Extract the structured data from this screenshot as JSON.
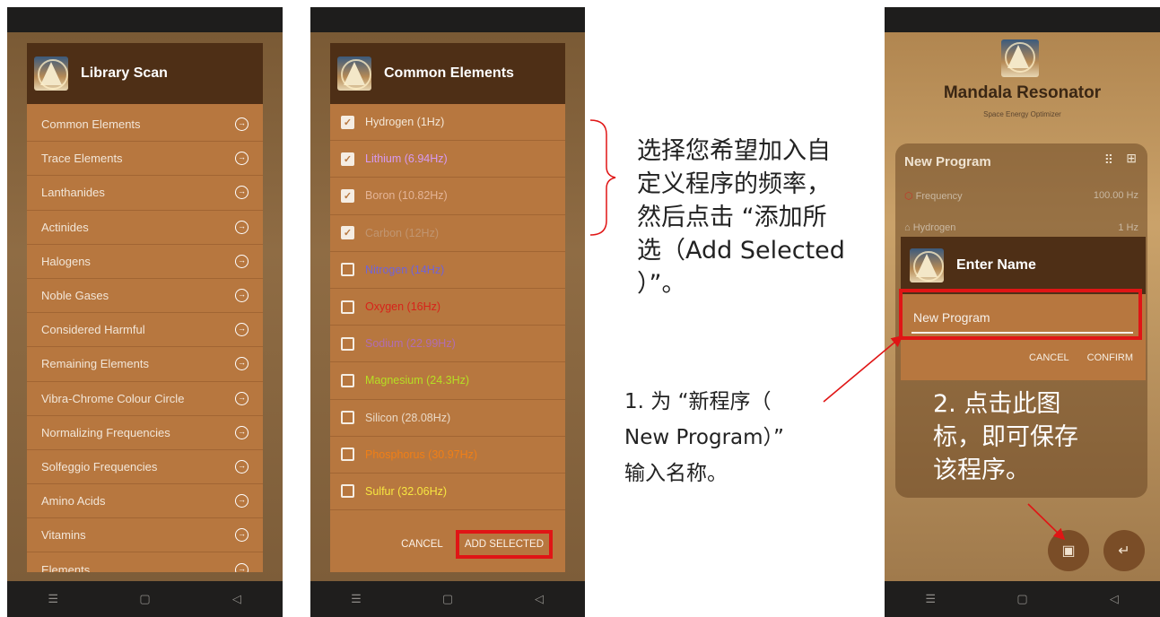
{
  "panel1": {
    "title": "Library Scan",
    "items": [
      {
        "label": "Common Elements"
      },
      {
        "label": "Trace Elements"
      },
      {
        "label": "Lanthanides"
      },
      {
        "label": "Actinides"
      },
      {
        "label": "Halogens"
      },
      {
        "label": "Noble Gases"
      },
      {
        "label": "Considered Harmful"
      },
      {
        "label": "Remaining Elements"
      },
      {
        "label": "Vibra-Chrome Colour Circle"
      },
      {
        "label": "Normalizing Frequencies"
      },
      {
        "label": "Solfeggio Frequencies"
      },
      {
        "label": "Amino Acids"
      },
      {
        "label": "Vitamins"
      },
      {
        "label": "Elements"
      }
    ]
  },
  "panel2": {
    "title": "Common Elements",
    "items": [
      {
        "label": "Hydrogen (1Hz)",
        "checked": true,
        "color": "#f3e6d6"
      },
      {
        "label": "Lithium (6.94Hz)",
        "checked": true,
        "color": "#d79af2"
      },
      {
        "label": "Boron (10.82Hz)",
        "checked": true,
        "color": "#e4b496"
      },
      {
        "label": "Carbon (12Hz)",
        "checked": true,
        "color": "#c19570"
      },
      {
        "label": "Nitrogen (14Hz)",
        "checked": false,
        "color": "#6f63d9"
      },
      {
        "label": "Oxygen (16Hz)",
        "checked": false,
        "color": "#d7231a"
      },
      {
        "label": "Sodium (22.99Hz)",
        "checked": false,
        "color": "#b16db2"
      },
      {
        "label": "Magnesium (24.3Hz)",
        "checked": false,
        "color": "#b6df24"
      },
      {
        "label": "Silicon (28.08Hz)",
        "checked": false,
        "color": "#ead9c6"
      },
      {
        "label": "Phosphorus (30.97Hz)",
        "checked": false,
        "color": "#f07f17"
      },
      {
        "label": "Sulfur (32.06Hz)",
        "checked": false,
        "color": "#f7e640"
      }
    ],
    "cancel": "CANCEL",
    "add_selected": "ADD SELECTED"
  },
  "annotations": {
    "note1_line1": "选择您希望加入自",
    "note1_line2": "定义程序的频率，",
    "note1_line3": "然后点击 “添加所",
    "note1_line4": "选（Add Selected",
    "note1_line5": "）”。",
    "note2_line1": "1. 为 “新程序（",
    "note2_line2": "New Program）”",
    "note2_line3": "输入名称。",
    "note3_line1": "2. 点击此图",
    "note3_line2": "标，即可保存",
    "note3_line3": "该程序。"
  },
  "panel3": {
    "app_title": "Mandala Resonator",
    "app_subtitle": "Space Energy Optimizer",
    "program_title": "New Program",
    "frequency_label": "Frequency",
    "frequency_value": "100.00 Hz",
    "hydrogen_label": "Hydrogen",
    "hydrogen_value": "1 Hz",
    "dialog_title": "Enter Name",
    "input_value": "New Program",
    "cancel": "CANCEL",
    "confirm": "CONFIRM",
    "save_icon": "save-icon",
    "back_icon": "return-icon"
  },
  "nav": {
    "menu": "☰",
    "home": "▢",
    "back": "◁"
  },
  "colors": {
    "highlight": "#e01515",
    "dialog": "#b7773f",
    "header": "#4e2f16"
  }
}
